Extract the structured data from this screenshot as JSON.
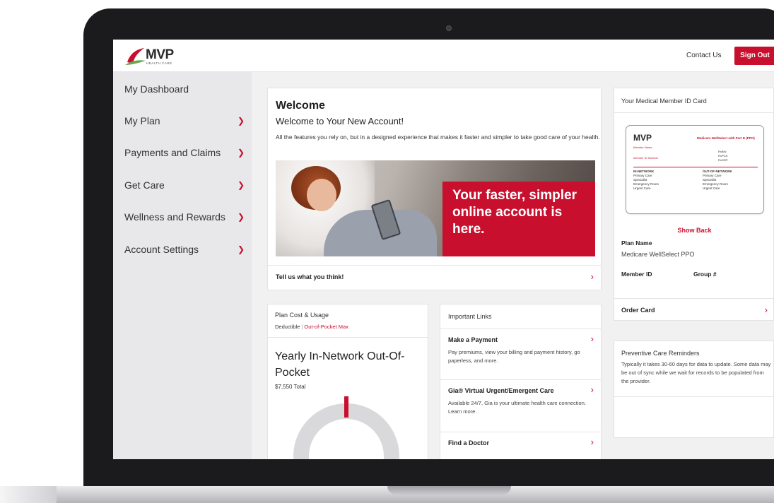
{
  "header": {
    "logo_text": "MVP",
    "logo_sub": "HEALTH CARE",
    "contact_label": "Contact Us",
    "signout_label": "Sign Out"
  },
  "sidebar": {
    "items": [
      {
        "label": "My Dashboard",
        "has_chevron": false
      },
      {
        "label": "My Plan",
        "has_chevron": true
      },
      {
        "label": "Payments and Claims",
        "has_chevron": true
      },
      {
        "label": "Get Care",
        "has_chevron": true
      },
      {
        "label": "Wellness and Rewards",
        "has_chevron": true
      },
      {
        "label": "Account Settings",
        "has_chevron": true
      }
    ],
    "chevron_icon": "chevron-down-icon"
  },
  "welcome": {
    "title": "Welcome",
    "subtitle": "Welcome to Your New Account!",
    "description": "All the features you rely on, but in a designed experience that makes it faster and simpler to take good care of your health.",
    "hero_text": "Your faster, simpler online account is here.",
    "feedback_label": "Tell us what you think!"
  },
  "plan_cost": {
    "title": "Plan Cost & Usage",
    "tab_deductible": "Deductible",
    "tab_separator": "|",
    "tab_oop": "Out-of-Pocket Max",
    "heading": "Yearly In-Network Out-Of-Pocket",
    "total": "$7,550 Total"
  },
  "important_links": {
    "title": "Important Links",
    "items": [
      {
        "label": "Make a Payment",
        "description": "Pay premiums, view your billing and payment history, go paperless, and more."
      },
      {
        "label": "Gia® Virtual Urgent/Emergent Care",
        "description": "Available 24/7, Gia is your ultimate health care connection. Learn more."
      },
      {
        "label": "Find a Doctor",
        "description": ""
      }
    ]
  },
  "id_card": {
    "title": "Your Medical Member ID Card",
    "card_logo": "MVP",
    "card_brand": "Medicare WellSelect with Part D (PPO)",
    "card_member_name": "Member Name",
    "card_member_id": "Member ID Number",
    "card_rx": [
      "RxBIN",
      "RxPCN",
      "RxGRP"
    ],
    "in_network_label": "IN-NETWORK",
    "out_network_label": "OUT-OF-NETWORK",
    "in_network_items": [
      "Primary Care",
      "Specialist",
      "Emergency Room",
      "Urgent Care"
    ],
    "out_network_items": [
      "Primary Care",
      "Specialist",
      "Emergency Room",
      "Urgent Care"
    ],
    "show_back_label": "Show Back",
    "plan_name_label": "Plan Name",
    "plan_name_value": "Medicare WellSelect PPO",
    "member_id_label": "Member ID",
    "group_label": "Group #",
    "order_card_label": "Order Card"
  },
  "reminders": {
    "title": "Preventive Care Reminders",
    "description": "Typically it takes 30-60 days for data to update. Some data may be out of sync while we wait for records to be populated from the provider."
  },
  "colors": {
    "brand_red": "#c8102e",
    "sidebar_bg": "#e8e8ea",
    "page_bg": "#f1f1f2"
  }
}
